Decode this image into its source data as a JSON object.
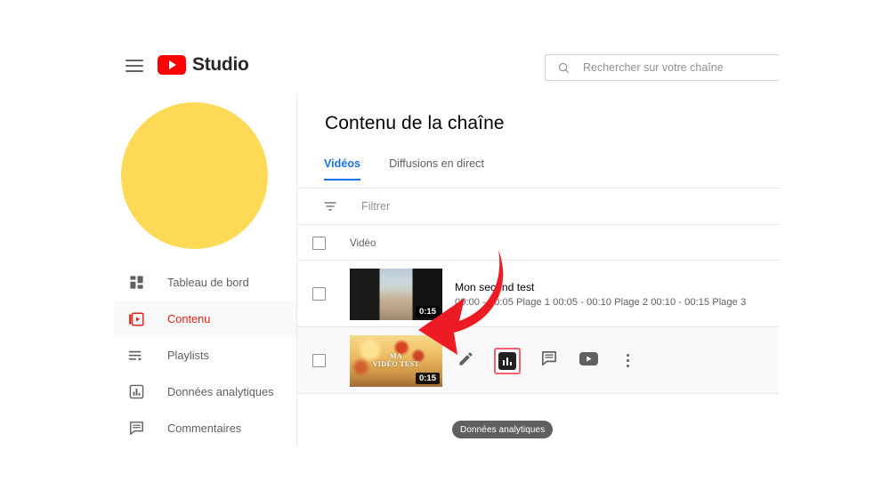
{
  "topbar": {
    "menu_icon": "hamburger-icon",
    "brand": "Studio",
    "logo_icon": "youtube-logo-icon",
    "search": {
      "icon": "search-icon",
      "placeholder": "Rechercher sur votre chaîne",
      "value": ""
    }
  },
  "sidebar": {
    "avatar_color": "#FDDA56",
    "items": [
      {
        "label": "Tableau de bord",
        "icon": "dashboard-icon",
        "active": false
      },
      {
        "label": "Contenu",
        "icon": "content-video-icon",
        "active": true
      },
      {
        "label": "Playlists",
        "icon": "playlist-icon",
        "active": false
      },
      {
        "label": "Données analytiques",
        "icon": "analytics-bar-icon",
        "active": false
      },
      {
        "label": "Commentaires",
        "icon": "comment-icon",
        "active": false
      }
    ]
  },
  "main": {
    "page_title": "Contenu de la chaîne",
    "tabs": [
      {
        "label": "Vidéos",
        "active": true
      },
      {
        "label": "Diffusions en direct",
        "active": false
      }
    ],
    "filter": {
      "icon": "filter-icon",
      "placeholder": "Filtrer"
    },
    "table": {
      "header": {
        "checkbox_checked": false,
        "column_video": "Vidéo"
      },
      "rows": [
        {
          "checkbox_checked": false,
          "thumbnail_style": "beach",
          "thumbnail_overlay_text": "",
          "duration": "0:15",
          "title": "Mon second test",
          "description": "00:00 - 00:05 Plage 1 00:05 - 00:10 Plage 2 00:10 - 00:15 Plage 3",
          "hovered": false
        },
        {
          "checkbox_checked": false,
          "thumbnail_style": "poppy",
          "thumbnail_overlay_line1": "MA",
          "thumbnail_overlay_line2": "VIDÉO TEST",
          "duration": "0:15",
          "title": "",
          "description": "",
          "hovered": true
        }
      ]
    },
    "row_actions": [
      {
        "name": "edit",
        "icon": "pencil-icon",
        "highlighted": false
      },
      {
        "name": "analytics",
        "icon": "analytics-bar-icon",
        "highlighted": true
      },
      {
        "name": "comments",
        "icon": "comment-icon",
        "highlighted": false
      },
      {
        "name": "watch-on-youtube",
        "icon": "youtube-play-icon",
        "highlighted": false
      },
      {
        "name": "options",
        "icon": "more-vertical-icon",
        "highlighted": false
      }
    ],
    "tooltip": "Données analytiques"
  },
  "annotation": {
    "arrow_color": "#ED1C24",
    "highlight_color": "#f4606c"
  }
}
